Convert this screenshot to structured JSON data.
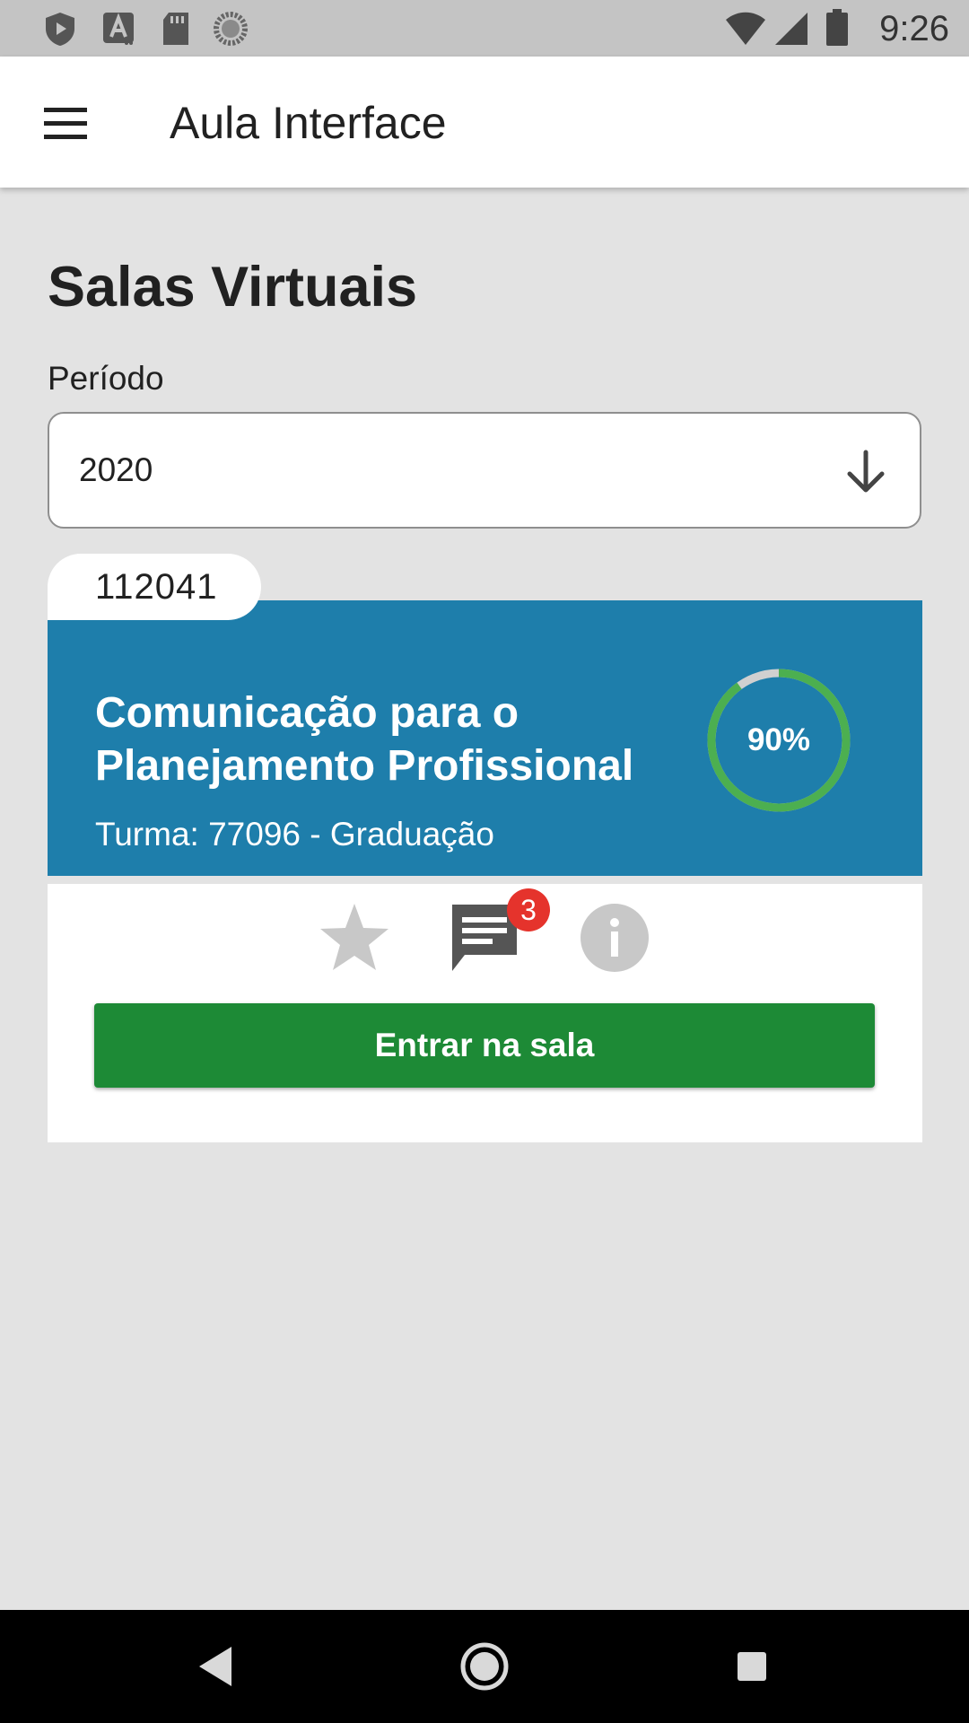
{
  "status_bar": {
    "time": "9:26",
    "left_icons": [
      "shield-play-icon",
      "text-a-icon",
      "sd-card-icon",
      "sync-dots-icon"
    ],
    "right_icons": [
      "wifi-icon",
      "signal-icon",
      "battery-icon"
    ]
  },
  "app_bar": {
    "title": "Aula Interface",
    "menu_icon": "hamburger-menu-icon"
  },
  "page": {
    "title": "Salas Virtuais",
    "period_label": "Período",
    "period_value": "2020"
  },
  "course": {
    "code": "112041",
    "name": "Comunicação para o Planejamento Profissional",
    "class_info": "Turma: 77096 - Graduação",
    "progress_fraction": 0.9,
    "progress_label": "90%",
    "message_count": "3",
    "enter_label": "Entrar na sala"
  },
  "colors": {
    "card": "#1e7eab",
    "progress": "#4caf50",
    "progress_track": "#d0d0d0",
    "button": "#1d8a36",
    "badge": "#e5332c"
  },
  "nav_bar": {
    "buttons": [
      "back-icon",
      "home-icon",
      "recents-icon"
    ]
  }
}
